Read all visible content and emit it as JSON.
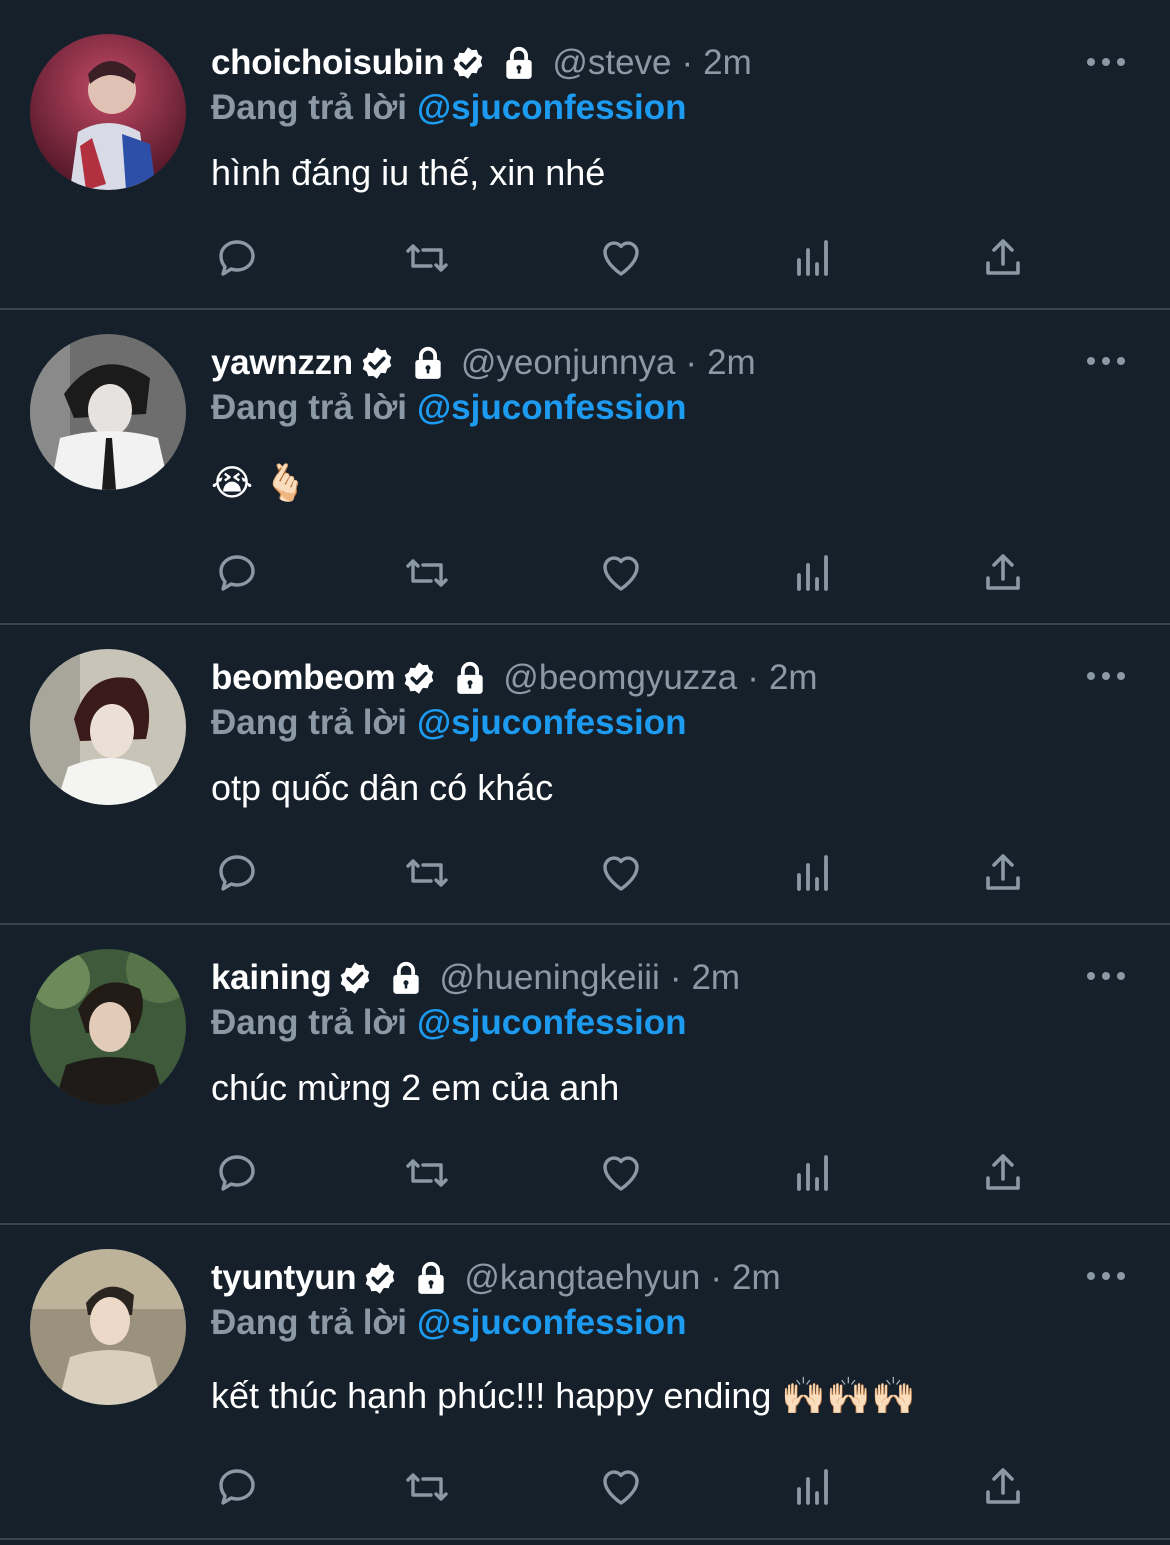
{
  "feed": {
    "tweets": [
      {
        "display_name": "choichoisubin",
        "handle": "@steve",
        "time": "2m",
        "reply_label": "Đang trả lời",
        "reply_to": "@sjuconfession",
        "text": "hình đáng iu thế, xin nhé"
      },
      {
        "display_name": "yawnzzn",
        "handle": "@yeonjunnya",
        "time": "2m",
        "reply_label": "Đang trả lời",
        "reply_to": "@sjuconfession",
        "text": "😭 🫰🏻"
      },
      {
        "display_name": "beombeom",
        "handle": "@beomgyuzza",
        "time": "2m",
        "reply_label": "Đang trả lời",
        "reply_to": "@sjuconfession",
        "text": "otp quốc dân có khác"
      },
      {
        "display_name": "kaining",
        "handle": "@hueningkeiii",
        "time": "2m",
        "reply_label": "Đang trả lời",
        "reply_to": "@sjuconfession",
        "text": "chúc mừng 2 em của anh"
      },
      {
        "display_name": "tyuntyun",
        "handle": "@kangtaehyun",
        "time": "2m",
        "reply_label": "Đang trả lời",
        "reply_to": "@sjuconfession",
        "text": "kết thúc hạnh phúc!!! happy ending 🙌🏻🙌🏻🙌🏻"
      }
    ],
    "separator": "·",
    "icons": {
      "verified": "verified-badge-icon",
      "protected": "lock-icon",
      "more": "more-options-icon",
      "reply": "reply-icon",
      "retweet": "retweet-icon",
      "like": "heart-icon",
      "views": "views-chart-icon",
      "share": "share-icon"
    },
    "colors": {
      "background": "#15202b",
      "divider": "#38444d",
      "secondary_text": "#8b98a5",
      "mention": "#1d9bf0",
      "icon": "#8b98a5"
    }
  }
}
